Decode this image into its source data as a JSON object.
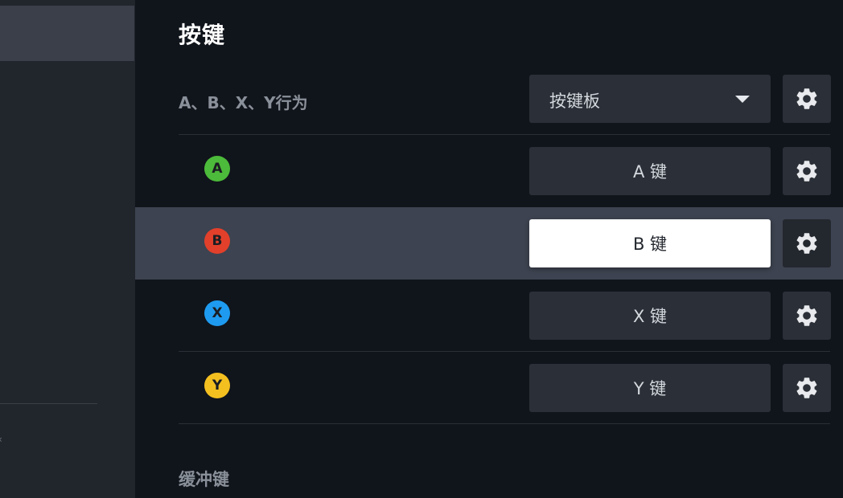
{
  "page": {
    "title": "按键"
  },
  "behavior": {
    "label": "A、B、X、Y行为",
    "selected": "按键板"
  },
  "buttons": [
    {
      "letter": "A",
      "mapping": "A 键",
      "color": "#4cba3a"
    },
    {
      "letter": "B",
      "mapping": "B 键",
      "color": "#e2402b"
    },
    {
      "letter": "X",
      "mapping": "X 键",
      "color": "#1e9bf0"
    },
    {
      "letter": "Y",
      "mapping": "Y 键",
      "color": "#f4c020"
    }
  ],
  "next_section": {
    "label": "缓冲键"
  },
  "icons": {
    "settings": "gear-icon",
    "dropdown": "chevron-down-icon"
  }
}
